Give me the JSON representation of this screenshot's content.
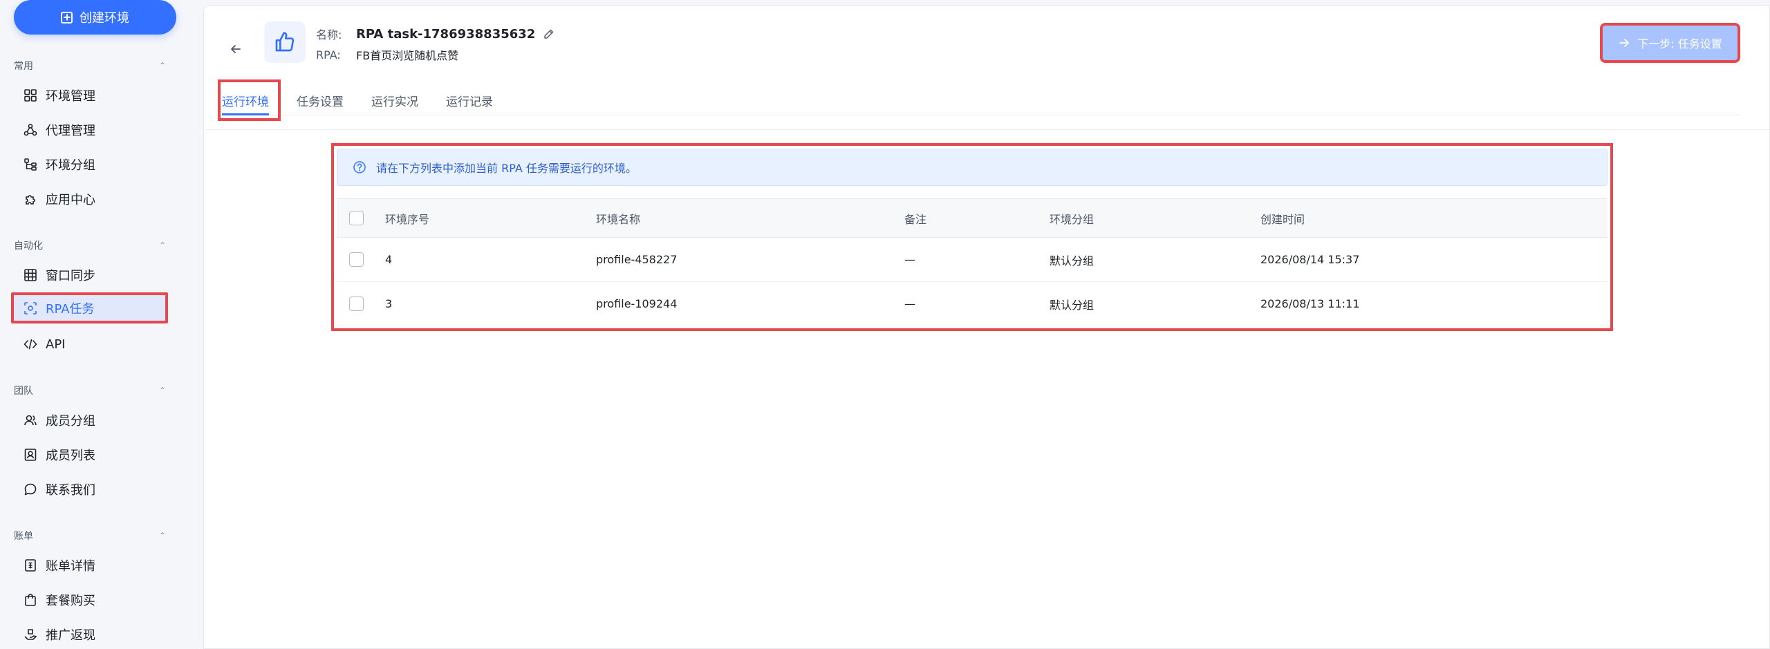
{
  "sidebar": {
    "create_button": "创建环境",
    "sections": [
      {
        "title": "常用",
        "items": [
          "环境管理",
          "代理管理",
          "环境分组",
          "应用中心"
        ]
      },
      {
        "title": "自动化",
        "items": [
          "窗口同步",
          "RPA任务",
          "API"
        ]
      },
      {
        "title": "团队",
        "items": [
          "成员分组",
          "成员列表",
          "联系我们"
        ]
      },
      {
        "title": "账单",
        "items": [
          "账单详情",
          "套餐购买",
          "推广返现"
        ]
      }
    ],
    "active_item": "RPA任务"
  },
  "header": {
    "name_label": "名称:",
    "task_name": "RPA task-1786938835632",
    "rpa_label": "RPA:",
    "rpa_value": "FB首页浏览随机点赞",
    "next_button": "下一步: 任务设置"
  },
  "tabs": [
    "运行环境",
    "任务设置",
    "运行实况",
    "运行记录"
  ],
  "active_tab": "运行环境",
  "notice": "请在下方列表中添加当前 RPA 任务需要运行的环境。",
  "table": {
    "columns": [
      "环境序号",
      "环境名称",
      "备注",
      "环境分组",
      "创建时间"
    ],
    "rows": [
      {
        "id": "4",
        "name": "profile-458227",
        "note": "—",
        "group": "默认分组",
        "created": "2026/08/14 15:37"
      },
      {
        "id": "3",
        "name": "profile-109244",
        "note": "—",
        "group": "默认分组",
        "created": "2026/08/13 11:11"
      }
    ]
  },
  "colors": {
    "accent": "#3370ff",
    "highlight": "#e5484d",
    "next_button_bg": "#a9c3ff"
  }
}
